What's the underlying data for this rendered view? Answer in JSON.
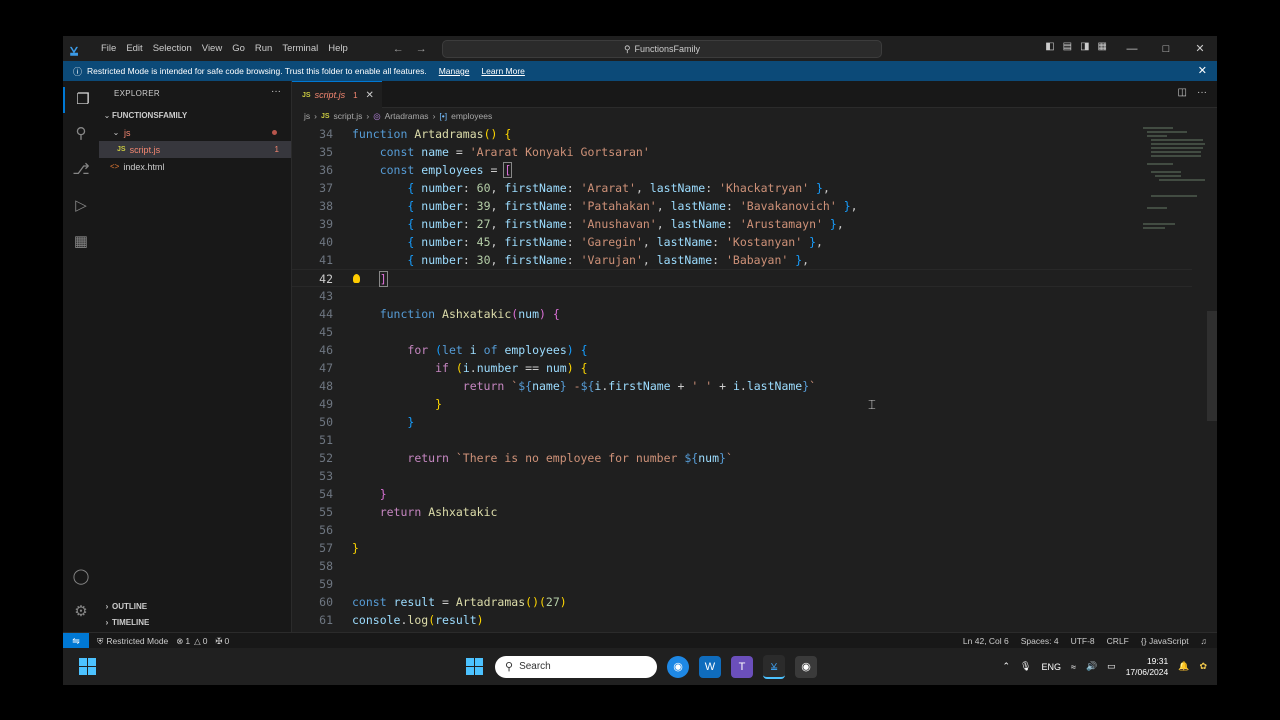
{
  "window": {
    "menu": [
      "File",
      "Edit",
      "Selection",
      "View",
      "Go",
      "Run",
      "Terminal",
      "Help"
    ],
    "command_center": "FunctionsFamily",
    "controls": [
      "—",
      "□",
      "✕"
    ]
  },
  "banner": {
    "message": "Restricted Mode is intended for safe code browsing. Trust this folder to enable all features.",
    "manage": "Manage",
    "learn_more": "Learn More"
  },
  "sidebar": {
    "title": "EXPLORER",
    "folder": "FUNCTIONSFAMILY",
    "items": [
      {
        "label": "js"
      },
      {
        "label": "script.js",
        "badge": "JS",
        "count": "1"
      },
      {
        "label": "index.html",
        "badge": "<>"
      }
    ],
    "outline": "OUTLINE",
    "timeline": "TIMELINE"
  },
  "editor": {
    "tab": {
      "label": "script.js",
      "badge": "JS",
      "problems": "1"
    },
    "breadcrumbs": [
      "js",
      "script.js",
      "Artadramas",
      "employees"
    ],
    "line_numbers": [
      "34",
      "35",
      "36",
      "37",
      "38",
      "39",
      "40",
      "41",
      "42",
      "43",
      "44",
      "45",
      "46",
      "47",
      "48",
      "49",
      "50",
      "51",
      "52",
      "53",
      "54",
      "55",
      "56",
      "57",
      "58",
      "59",
      "60",
      "61"
    ]
  },
  "status": {
    "mode": "Restricted Mode",
    "errors": "1",
    "warnings": "0",
    "ports": "0",
    "position": "Ln 42, Col 6",
    "spaces": "Spaces: 4",
    "encoding": "UTF-8",
    "eol": "CRLF",
    "language": "JavaScript"
  },
  "taskbar": {
    "search_label": "Search",
    "language": "ENG",
    "time": "19:31",
    "date": "17/06/2024"
  },
  "colors": {
    "accent": "#0078d4",
    "banner": "#0c4a78",
    "editor_bg": "#1f1f1f"
  }
}
